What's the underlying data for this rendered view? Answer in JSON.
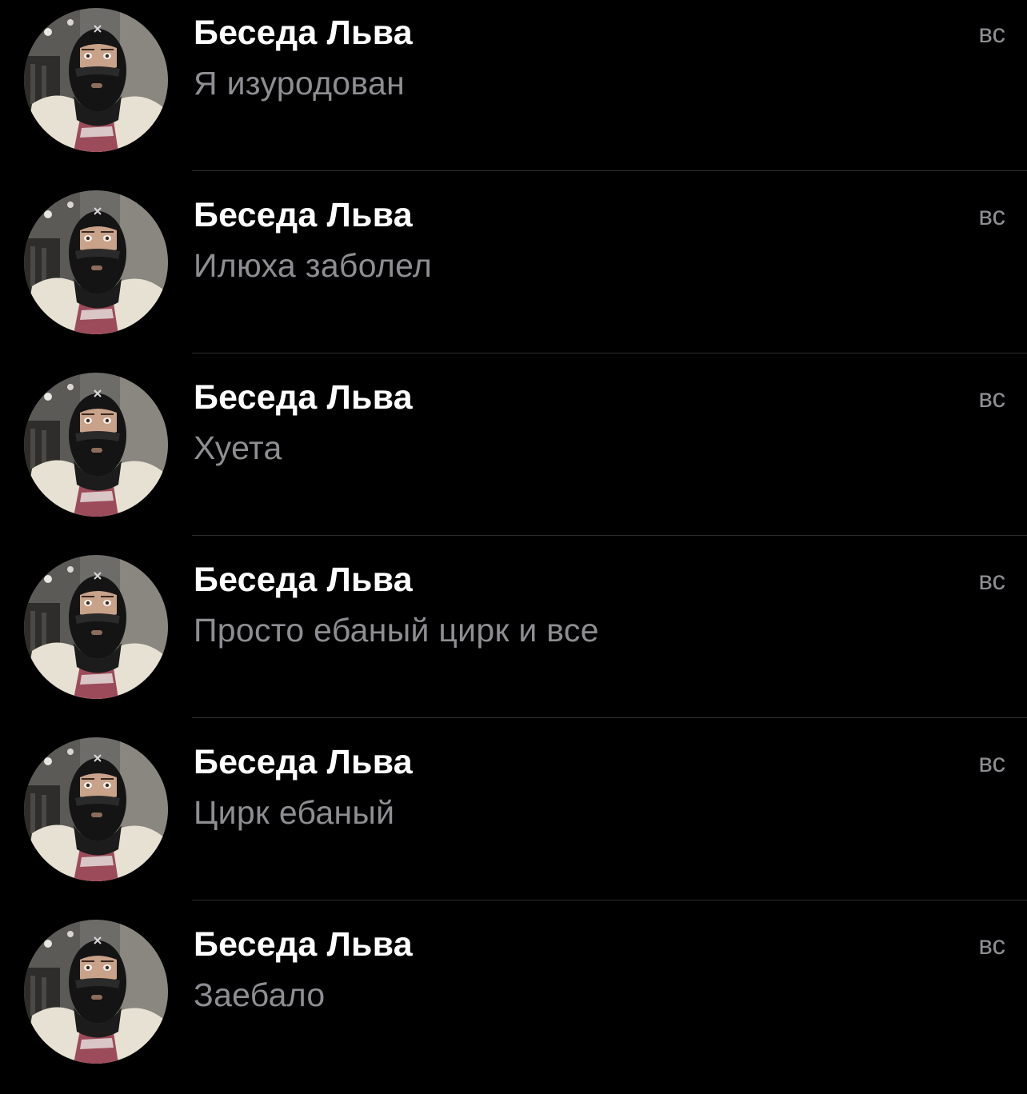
{
  "colors": {
    "background": "#000000",
    "title": "#ffffff",
    "secondary": "#8d8d92",
    "separator": "#2e2e30"
  },
  "chats": [
    {
      "title": "Беседа Льва",
      "preview": "Я изуродован",
      "time": "вс",
      "avatar_icon": "group-avatar-masked-person"
    },
    {
      "title": "Беседа Льва",
      "preview": "Илюха заболел",
      "time": "вс",
      "avatar_icon": "group-avatar-masked-person"
    },
    {
      "title": "Беседа Льва",
      "preview": "Хуета",
      "time": "вс",
      "avatar_icon": "group-avatar-masked-person"
    },
    {
      "title": "Беседа Льва",
      "preview": "Просто ебаный цирк и все",
      "time": "вс",
      "avatar_icon": "group-avatar-masked-person"
    },
    {
      "title": "Беседа Льва",
      "preview": "Цирк ебаный",
      "time": "вс",
      "avatar_icon": "group-avatar-masked-person"
    },
    {
      "title": "Беседа Льва",
      "preview": "Заебало",
      "time": "вс",
      "avatar_icon": "group-avatar-masked-person"
    }
  ]
}
